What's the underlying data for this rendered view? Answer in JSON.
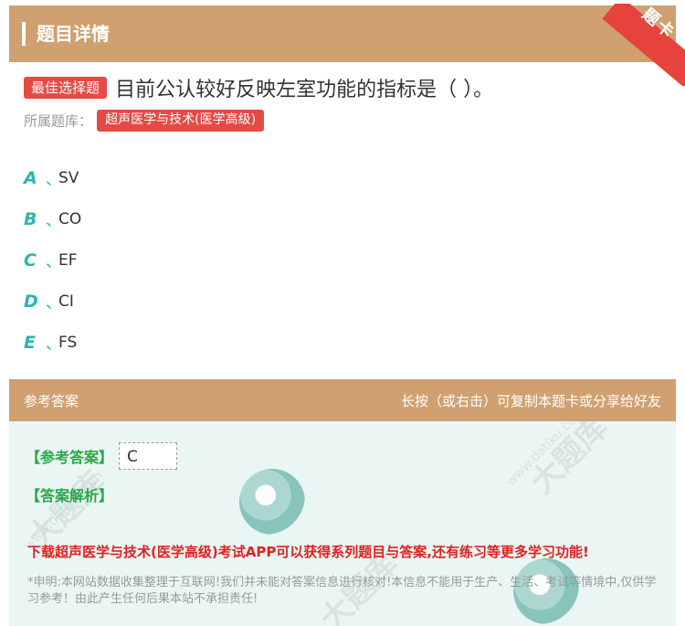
{
  "header": {
    "title": "题目详情",
    "ribbon": "题卡"
  },
  "question": {
    "type_badge": "最佳选择题",
    "text": "目前公认较好反映左室功能的指标是（ ）。",
    "bank_label": "所属题库：",
    "bank_name": "超声医学与技术(医学高级)"
  },
  "options": [
    {
      "letter": "A",
      "sep": "、",
      "text": "SV"
    },
    {
      "letter": "B",
      "sep": "、",
      "text": "CO"
    },
    {
      "letter": "C",
      "sep": "、",
      "text": "EF"
    },
    {
      "letter": "D",
      "sep": "、",
      "text": "CI"
    },
    {
      "letter": "E",
      "sep": "、",
      "text": "FS"
    }
  ],
  "answer": {
    "header_left": "参考答案",
    "header_right": "长按（或右击）可复制本题卡或分享给好友",
    "ref_label": "【参考答案】",
    "ref_value": "C",
    "analysis_label": "【答案解析】",
    "promo": "下载超声医学与技术(医学高级)考试APP可以获得系列题目与答案,还有练习等更多学习功能!",
    "disclaimer": "*申明:本网站数据收集整理于互联网!我们并未能对答案信息进行核对!本信息不能用于生产、生活、考试等情境中,仅供学习参考！由此产生任何后果本站不承担责任!"
  },
  "watermark": {
    "brand": "大题库",
    "url": "www.datiku.com"
  },
  "colors": {
    "header": "#d0a070",
    "badge": "#e64a45",
    "option_letter": "#2cb5ad",
    "promo": "#e0221e"
  }
}
